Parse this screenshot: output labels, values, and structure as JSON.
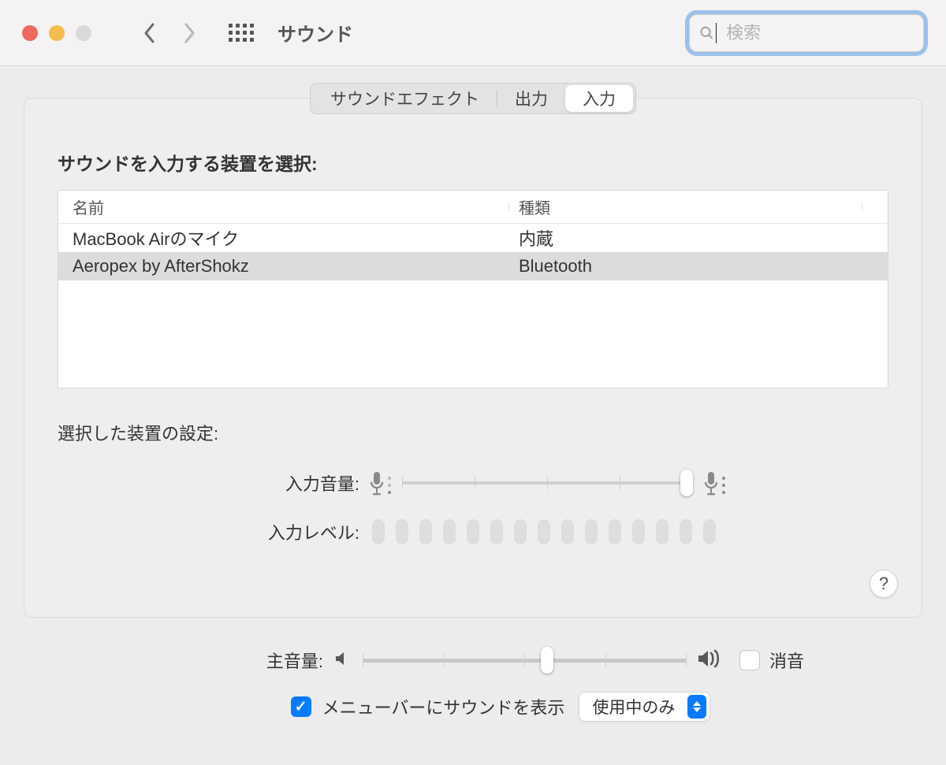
{
  "window": {
    "title": "サウンド"
  },
  "search": {
    "placeholder": "検索"
  },
  "tabs": {
    "sound_effects": "サウンドエフェクト",
    "output": "出力",
    "input": "入力"
  },
  "input_panel": {
    "select_device_header": "サウンドを入力する装置を選択:",
    "columns": {
      "name": "名前",
      "type": "種類"
    },
    "devices": [
      {
        "name": "MacBook Airのマイク",
        "type": "内蔵"
      },
      {
        "name": "Aeropex by AfterShokz",
        "type": "Bluetooth"
      }
    ],
    "selected_index": 1,
    "settings_header": "選択した装置の設定:",
    "input_volume_label": "入力音量:",
    "input_volume_value": 0.96,
    "input_level_label": "入力レベル:",
    "input_level_cells": 15
  },
  "main_volume": {
    "label": "主音量:",
    "value": 0.55,
    "mute_label": "消音",
    "mute_checked": false
  },
  "menu_bar": {
    "show_checked": true,
    "show_label": "メニューバーにサウンドを表示",
    "popup_value": "使用中のみ"
  },
  "help_label": "?"
}
